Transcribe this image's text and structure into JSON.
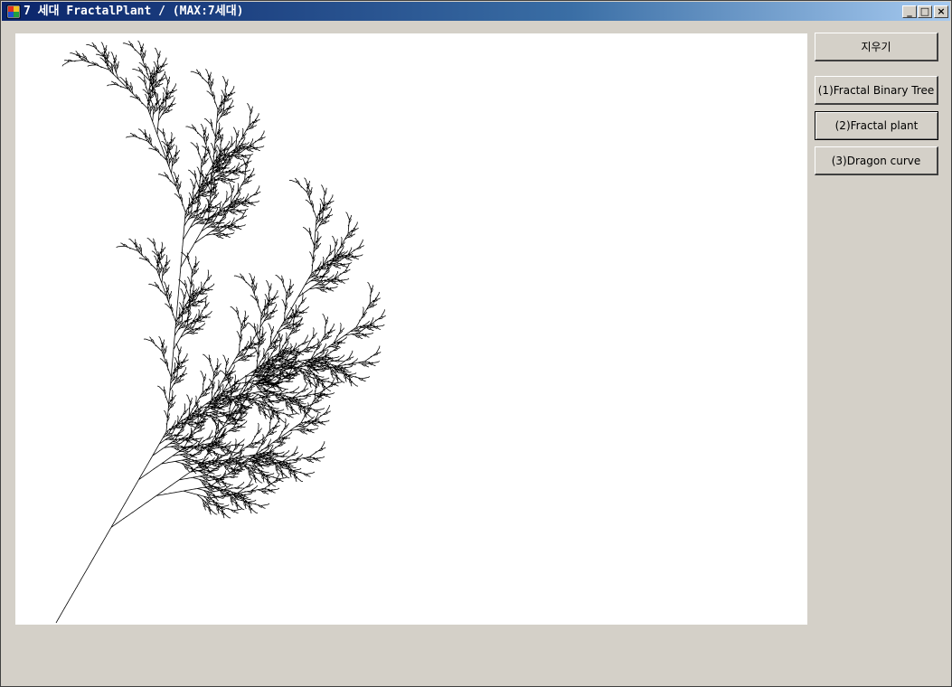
{
  "window": {
    "title": "7 세대 FractalPlant / (MAX:7세대)",
    "controls": {
      "minimize": "_",
      "maximize": "□",
      "close": "×"
    }
  },
  "buttons": {
    "clear": "지우기",
    "binary_tree": "(1)Fractal Binary Tree",
    "fractal_plant": "(2)Fractal plant",
    "dragon_curve": "(3)Dragon curve"
  },
  "active_button": "fractal_plant",
  "fractal": {
    "type": "fractal-plant",
    "generation": 7,
    "max_generation": 7,
    "stroke_color": "#000000",
    "background_color": "#ffffff"
  },
  "icons": {
    "app": "app-icon"
  }
}
